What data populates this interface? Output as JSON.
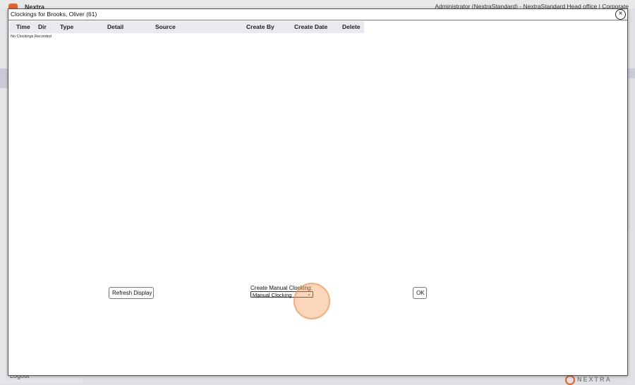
{
  "background": {
    "brand": "Nextra",
    "header_text": "Administrator (NextraStandard) - NextraStandard Head office | Corporate",
    "logout": "Logout",
    "footer_brand": "NEXTRA"
  },
  "dialog": {
    "title": "Clockings for Brooks, Oliver (61)",
    "close_symbol": "×",
    "columns": [
      "Time",
      "Dir",
      "Type",
      "Detail",
      "Source",
      "Create By",
      "Create Date",
      "Delete"
    ],
    "empty_message": "No Clockings Recorded",
    "refresh_label": "Refresh Display",
    "manual_label": "Create Manual Clocking:",
    "manual_selected": "Manual Clocking",
    "ok_label": "OK"
  },
  "colors": {
    "accent": "#e8622a",
    "highlight": "#f59e5c"
  }
}
